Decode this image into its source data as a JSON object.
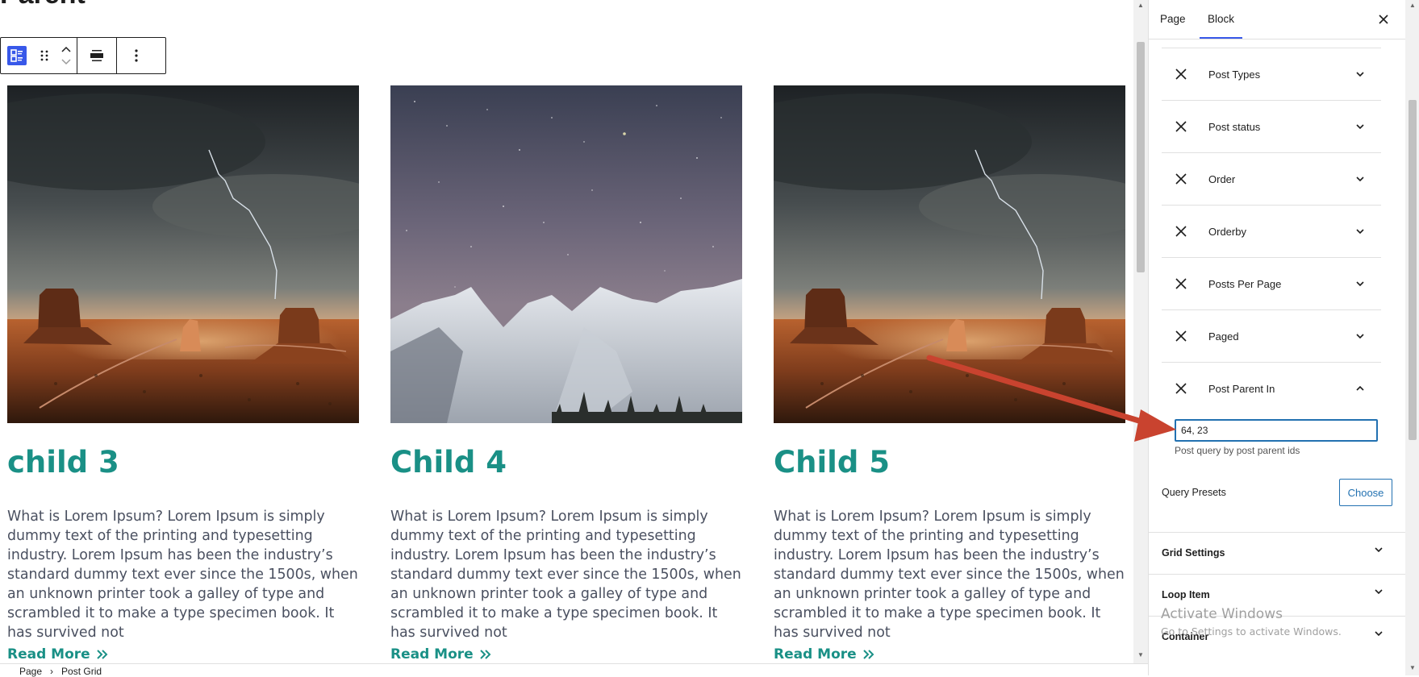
{
  "canvas": {
    "heading": "Parent",
    "cards": [
      {
        "title": "child 3",
        "text": "What is Lorem Ipsum? Lorem Ipsum is simply dummy text of the printing and typesetting industry. Lorem Ipsum has been the industry’s standard dummy text ever since the 1500s, when an unknown printer took a galley of type and scrambled it to make a type specimen book. It has survived not",
        "read_more": "Read More",
        "image": "desert-butte-storm"
      },
      {
        "title": "Child 4",
        "text": "What is Lorem Ipsum? Lorem Ipsum is simply dummy text of the printing and typesetting industry. Lorem Ipsum has been the industry’s standard dummy text ever since the 1500s, when an unknown printer took a galley of type and scrambled it to make a type specimen book. It has survived not",
        "read_more": "Read More",
        "image": "snowy-mountain-starry-sky"
      },
      {
        "title": "Child 5",
        "text": "What is Lorem Ipsum? Lorem Ipsum is simply dummy text of the printing and typesetting industry. Lorem Ipsum has been the industry’s standard dummy text ever since the 1500s, when an unknown printer took a galley of type and scrambled it to make a type specimen book. It has survived not",
        "read_more": "Read More",
        "image": "desert-butte-storm"
      }
    ]
  },
  "breadcrumb": [
    "Page",
    "Post Grid"
  ],
  "sidebar": {
    "tabs": [
      "Page",
      "Block"
    ],
    "active_tab": "Block",
    "query_rows": [
      "Post Types",
      "Post status",
      "Order",
      "Orderby",
      "Posts Per Page",
      "Paged",
      "Post Parent In"
    ],
    "post_parent_in": {
      "value": "64, 23",
      "help": "Post query by post parent ids"
    },
    "query_presets_label": "Query Presets",
    "choose_label": "Choose",
    "sections": [
      "Grid Settings",
      "Loop Item",
      "Container"
    ]
  },
  "watermark": {
    "title": "Activate Windows",
    "subtitle": "Go to Settings to activate Windows."
  },
  "colors": {
    "accent": "#3858e9",
    "brand_teal": "#1a9086",
    "link_blue": "#2271b1",
    "annotation_arrow": "#c9432f"
  }
}
